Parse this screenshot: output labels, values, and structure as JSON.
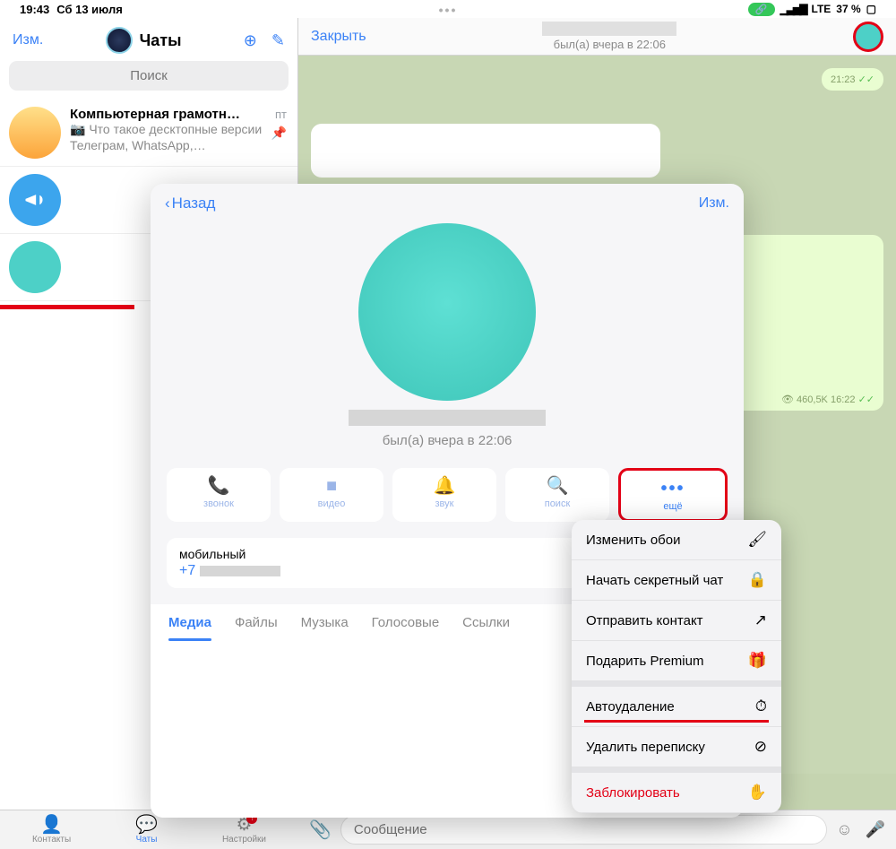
{
  "status": {
    "time": "19:43",
    "date": "Сб 13 июля",
    "network": "LTE",
    "battery_pct": "37 %"
  },
  "sidebar": {
    "edit": "Изм.",
    "title": "Чаты",
    "search_placeholder": "Поиск",
    "actions": {
      "add_icon": "add-story-icon",
      "compose_icon": "compose-icon"
    },
    "chats": [
      {
        "name": "Компьютерная грамотност…",
        "time": "пт",
        "preview": "📷 Что такое десктопные версии Телеграм, WhatsApp,…",
        "pinned": true
      },
      {
        "name": "",
        "time": "",
        "preview": ""
      },
      {
        "name": "",
        "time": "",
        "preview": ""
      }
    ]
  },
  "chat_header": {
    "close": "Закрыть",
    "last_seen": "был(а) вчера в 22:06"
  },
  "chat": {
    "time1": "21:23",
    "views": "460,5K",
    "time2": "16:22"
  },
  "input": {
    "placeholder": "Сообщение"
  },
  "tabs": [
    {
      "label": "Контакты",
      "active": false
    },
    {
      "label": "Чаты",
      "active": true
    },
    {
      "label": "Настройки",
      "active": false,
      "badge": "!"
    }
  ],
  "modal": {
    "back": "Назад",
    "edit": "Изм.",
    "last_seen": "был(а) вчера в 22:06",
    "actions": [
      {
        "label": "звонок",
        "icon": "phone-icon"
      },
      {
        "label": "видео",
        "icon": "video-icon"
      },
      {
        "label": "звук",
        "icon": "bell-icon"
      },
      {
        "label": "поиск",
        "icon": "search-icon"
      },
      {
        "label": "ещё",
        "icon": "more-icon",
        "highlight": true
      }
    ],
    "info": {
      "label": "мобильный",
      "value_prefix": "+7"
    },
    "tabs": [
      {
        "label": "Медиа",
        "active": true
      },
      {
        "label": "Файлы"
      },
      {
        "label": "Музыка"
      },
      {
        "label": "Голосовые"
      },
      {
        "label": "Ссылки"
      }
    ]
  },
  "menu": {
    "items": [
      {
        "label": "Изменить обои",
        "icon": "brush-icon"
      },
      {
        "label": "Начать секретный чат",
        "icon": "lock-icon"
      },
      {
        "label": "Отправить контакт",
        "icon": "share-icon"
      },
      {
        "label": "Подарить Premium",
        "icon": "gift-icon"
      }
    ],
    "items2": [
      {
        "label": "Автоудаление",
        "icon": "timer-icon",
        "underlined": true
      },
      {
        "label": "Удалить переписку",
        "icon": "trash-icon"
      }
    ],
    "danger": {
      "label": "Заблокировать",
      "icon": "hand-icon"
    }
  }
}
